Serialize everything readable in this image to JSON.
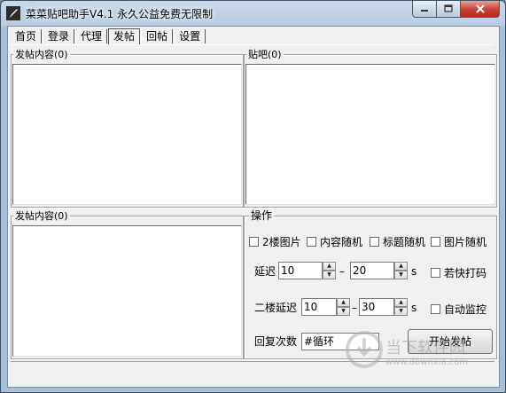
{
  "window": {
    "title": "菜菜贴吧助手V4.1  永久公益免费无限制"
  },
  "tabs": [
    "首页",
    "登录",
    "代理",
    "发帖",
    "回帖",
    "设置"
  ],
  "active_tab": "发帖",
  "groups": {
    "post_content_top": "发帖内容(0)",
    "tieba": "贴吧(0)",
    "post_content_bottom": "发帖内容(0)",
    "operations": "操作"
  },
  "options": {
    "checkbox_2floor_image": "2楼图片",
    "checkbox_content_random": "内容随机",
    "checkbox_title_random": "标题随机",
    "checkbox_image_random": "图片随机",
    "delay_label": "延迟",
    "delay_min": "10",
    "delay_max": "20",
    "delay_dash": "–",
    "delay_unit": "s",
    "checkbox_fast_captcha": "若快打码",
    "second_floor_delay_label": "二楼延迟",
    "second_floor_delay_min": "10",
    "second_floor_delay_max": "30",
    "second_floor_delay_dash": "–",
    "second_floor_delay_unit": "s",
    "checkbox_auto_monitor": "自动监控",
    "reply_count_label": "回复次数",
    "reply_count_value": "#循环",
    "start_button": "开始发帖"
  },
  "watermark": {
    "line1": "当下软件园",
    "line2": "www.downxia.com"
  },
  "icons": {
    "app": "pencil-icon",
    "minimize": "minimize-icon",
    "maximize": "maximize-icon",
    "close": "close-icon",
    "spin_up": "triangle-up-icon",
    "spin_down": "triangle-down-icon"
  },
  "colors": {
    "titlebar": "#b8cde2",
    "client": "#f0f0f0",
    "close_button": "#c7443a"
  }
}
